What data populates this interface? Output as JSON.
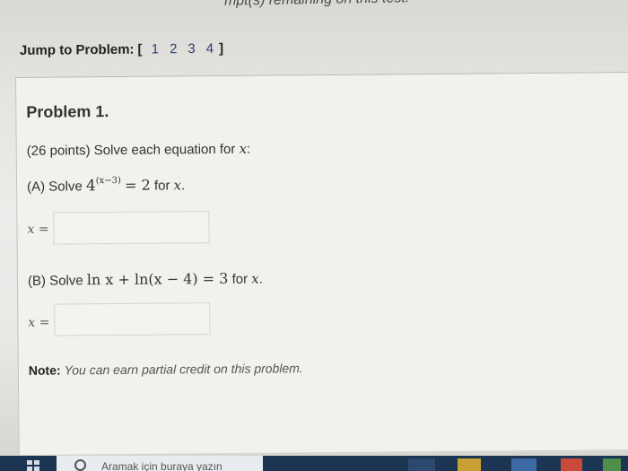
{
  "header": {
    "top_text": "mpt(s) remaining on this test.",
    "jump_label": "Jump to Problem:",
    "open_bracket": "[",
    "close_bracket": "]",
    "problems": [
      "1",
      "2",
      "3",
      "4"
    ]
  },
  "problem": {
    "title": "Problem 1.",
    "intro_prefix": "(26 points) Solve each equation for",
    "intro_var": "x",
    "intro_suffix": ":",
    "part_a_prefix": "(A) Solve",
    "part_a_base": "4",
    "part_a_exponent": "(x−3)",
    "part_a_rhs": "= 2",
    "part_a_for": "for",
    "part_a_var": "x",
    "part_a_end": ".",
    "answer_a_label": "x =",
    "answer_a_value": "",
    "part_b_prefix": "(B) Solve",
    "part_b_equation": "ln x + ln(x − 4) = 3",
    "part_b_for": "for",
    "part_b_var": "x",
    "part_b_end": ".",
    "answer_b_label": "x =",
    "answer_b_value": "",
    "note_label": "Note:",
    "note_text": "You can earn partial credit on this problem."
  },
  "taskbar": {
    "search_text": "Aramak için buraya yazın"
  },
  "colors": {
    "taskbar": "#1b3553",
    "link": "#2a3c70"
  }
}
